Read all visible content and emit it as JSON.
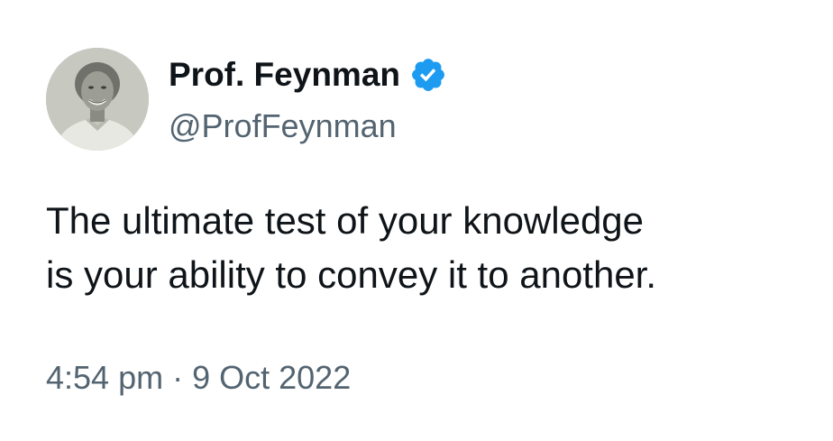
{
  "author": {
    "display_name": "Prof. Feynman",
    "handle": "@ProfFeynman",
    "verified": true,
    "verified_icon": "verified-badge-icon",
    "verified_color": "#1d9bf0"
  },
  "tweet": {
    "text_line_1": "The ultimate test of your knowledge",
    "text_line_2": "is your ability to convey it to another.",
    "time": "4:54 pm",
    "separator": "·",
    "date": "9 Oct 2022"
  },
  "colors": {
    "text_primary": "#0f1419",
    "text_secondary": "#536471",
    "background": "#ffffff"
  }
}
